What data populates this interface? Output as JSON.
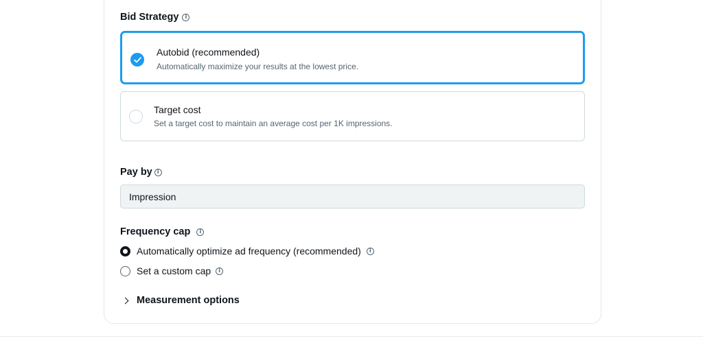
{
  "bid_strategy": {
    "title": "Bid Strategy",
    "info_icon": "i",
    "options": [
      {
        "title": "Autobid (recommended)",
        "description": "Automatically maximize your results at the lowest price.",
        "selected": true
      },
      {
        "title": "Target cost",
        "description": "Set a target cost to maintain an average cost per 1K impressions.",
        "selected": false
      }
    ]
  },
  "pay_by": {
    "title": "Pay by",
    "info_icon": "i",
    "value": "Impression"
  },
  "frequency_cap": {
    "title": "Frequency cap",
    "info_icon": "i",
    "options": [
      {
        "label": "Automatically optimize ad frequency (recommended)",
        "selected": true,
        "info_icon": "i"
      },
      {
        "label": "Set a custom cap",
        "selected": false,
        "info_icon": "i"
      }
    ]
  },
  "measurement": {
    "label": "Measurement options",
    "icon": "chevron-right-icon"
  },
  "colors": {
    "accent": "#1d9bf0",
    "text": "#0f1419",
    "muted": "#536471",
    "border": "#cfd9de",
    "field_bg": "#eff3f4"
  }
}
